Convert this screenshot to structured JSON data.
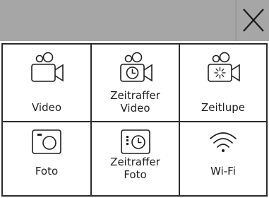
{
  "header": {
    "close_icon": "close-icon",
    "background": "#a6a6a6"
  },
  "modes": [
    {
      "label": "Video",
      "icon": "video-camera-icon"
    },
    {
      "label": "Zeitraffer\nVideo",
      "label_line1": "Zeitraffer",
      "label_line2": "Video",
      "icon": "timelapse-video-icon"
    },
    {
      "label": "Zeitlupe",
      "icon": "slow-motion-icon"
    },
    {
      "label": "Foto",
      "icon": "photo-camera-icon"
    },
    {
      "label_line1": "Zeitraffer",
      "label_line2": "Foto",
      "icon": "timelapse-photo-icon"
    },
    {
      "label": "Wi-Fi",
      "icon": "wifi-icon"
    }
  ]
}
